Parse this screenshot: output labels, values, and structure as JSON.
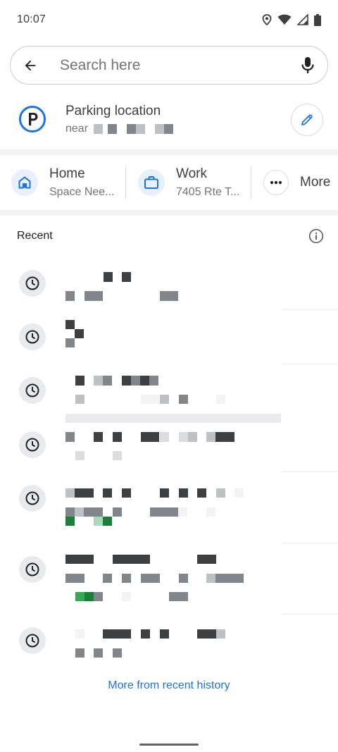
{
  "status": {
    "time": "10:07"
  },
  "search": {
    "placeholder": "Search here"
  },
  "parking": {
    "title": "Parking location",
    "near": "near"
  },
  "shortcuts": {
    "home": {
      "title": "Home",
      "subtitle": "Space Nee..."
    },
    "work": {
      "title": "Work",
      "subtitle": "7405 Rte T..."
    },
    "more": {
      "title": "More"
    }
  },
  "recent": {
    "title": "Recent",
    "more_history": "More from recent history"
  },
  "colors": {
    "accent": "#1a73e8",
    "dark_block": "#3c4043",
    "mid_block": "#80868b",
    "light_block": "#bdc1c6",
    "faint_block": "#f1f3f4",
    "green": "#188038",
    "light_green": "#81c995"
  },
  "icons": {
    "back": "arrow-left-icon",
    "mic": "mic-icon",
    "parking": "parking-icon",
    "edit": "pencil-icon",
    "home": "home-icon",
    "work": "briefcase-icon",
    "more": "more-dots-icon",
    "info": "info-icon",
    "clock": "clock-icon"
  }
}
